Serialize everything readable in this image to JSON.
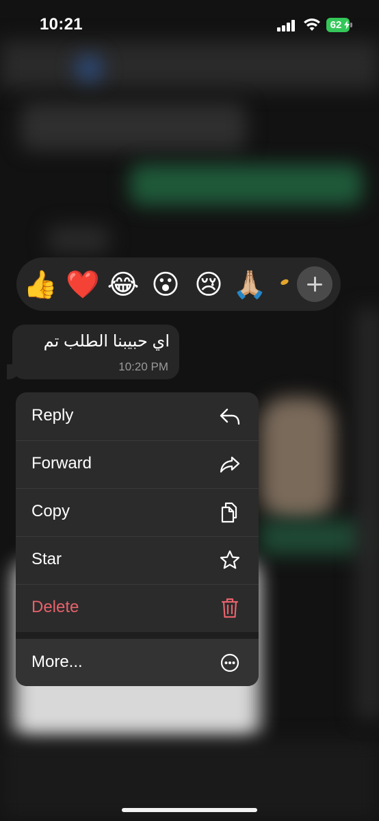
{
  "status_bar": {
    "time": "10:21",
    "battery_percent": "62",
    "battery_color": "#34c759"
  },
  "reactions": {
    "emojis": [
      "👍",
      "❤️",
      "😂",
      "😮",
      "😢",
      "🙏🏼"
    ],
    "more_icon": "plus-icon"
  },
  "message": {
    "text": "اي حبيبنا الطلب تم",
    "time": "10:20 PM"
  },
  "menu": {
    "items": [
      {
        "label": "Reply",
        "icon": "reply-icon"
      },
      {
        "label": "Forward",
        "icon": "forward-icon"
      },
      {
        "label": "Copy",
        "icon": "copy-icon"
      },
      {
        "label": "Star",
        "icon": "star-icon"
      },
      {
        "label": "Delete",
        "icon": "trash-icon",
        "color": "#e8626b"
      },
      {
        "label": "More...",
        "icon": "more-icon"
      }
    ]
  }
}
